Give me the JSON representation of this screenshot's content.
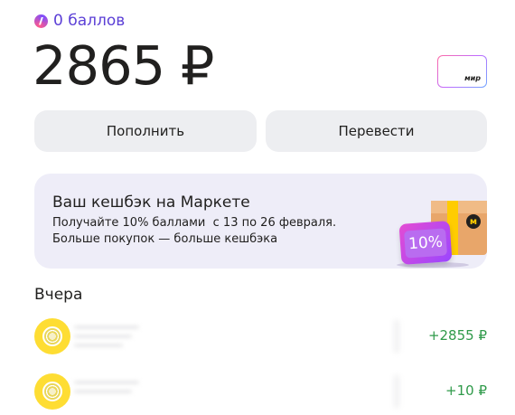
{
  "points": {
    "icon": "plus-points-icon",
    "label": "0 баллов"
  },
  "balance": "2865 ₽",
  "card": {
    "brand": "мир"
  },
  "actions": {
    "topup_label": "Пополнить",
    "transfer_label": "Перевести"
  },
  "promo": {
    "title": "Ваш кешбэк на Маркете",
    "text": "Получайте 10% баллами  с 13 по 26 февраля. Больше покупок — больше кешбэка",
    "badge": "10%",
    "box_mark": "м"
  },
  "history": {
    "section_title": "Вчера",
    "items": [
      {
        "amount": "+2855 ₽",
        "icon": "merchant-avatar-icon"
      },
      {
        "amount": "+10 ₽",
        "icon": "merchant-avatar-icon"
      }
    ]
  },
  "colors": {
    "accent": "#5b3fd6",
    "positive": "#2f9a4a",
    "promo_bg": "#eeedf8",
    "button_bg": "#edeef1"
  }
}
